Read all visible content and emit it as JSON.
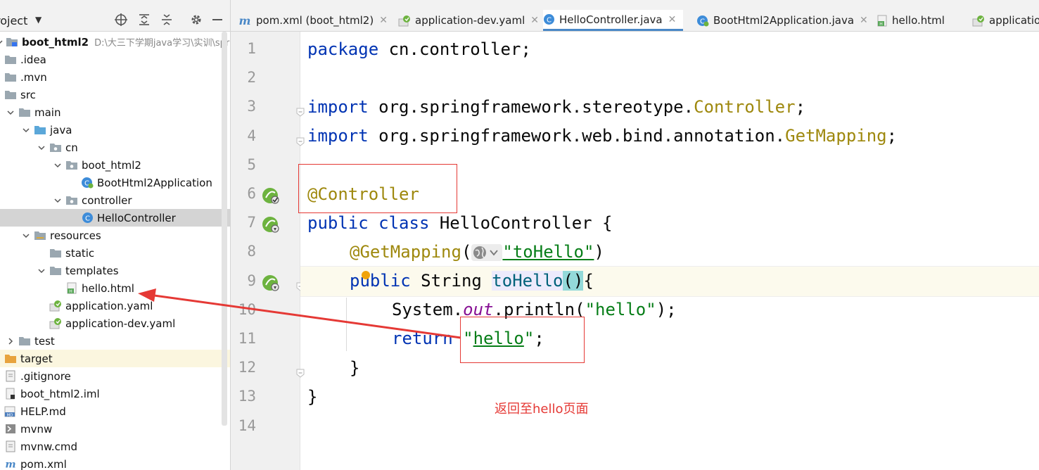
{
  "project": {
    "title": "roject",
    "tree": [
      {
        "label": "boot_html2",
        "extra": "D:\\大三下学期java学习\\实训\\spri",
        "type": "module",
        "indent": 0,
        "arrow": "down"
      },
      {
        "label": ".idea",
        "type": "folder",
        "indent": 0
      },
      {
        "label": ".mvn",
        "type": "folder",
        "indent": 0
      },
      {
        "label": "src",
        "type": "folder",
        "indent": 0
      },
      {
        "label": "main",
        "type": "folder",
        "indent": 1,
        "arrow": "down"
      },
      {
        "label": "java",
        "type": "folder-src",
        "indent": 2,
        "arrow": "down"
      },
      {
        "label": "cn",
        "type": "package",
        "indent": 3,
        "arrow": "down"
      },
      {
        "label": "boot_html2",
        "type": "package",
        "indent": 4,
        "arrow": "down"
      },
      {
        "label": "BootHtml2Application",
        "type": "spring-class",
        "indent": 5
      },
      {
        "label": "controller",
        "type": "package",
        "indent": 4,
        "arrow": "down"
      },
      {
        "label": "HelloController",
        "type": "class",
        "indent": 5,
        "selected": true
      },
      {
        "label": "resources",
        "type": "folder-res",
        "indent": 2,
        "arrow": "down"
      },
      {
        "label": "static",
        "type": "folder",
        "indent": 3
      },
      {
        "label": "templates",
        "type": "folder",
        "indent": 3,
        "arrow": "down"
      },
      {
        "label": "hello.html",
        "type": "html",
        "indent": 4
      },
      {
        "label": "application.yaml",
        "type": "yaml",
        "indent": 3
      },
      {
        "label": "application-dev.yaml",
        "type": "yaml",
        "indent": 3
      },
      {
        "label": "test",
        "type": "folder",
        "indent": 1,
        "arrow": "right"
      },
      {
        "label": "target",
        "type": "folder-excluded",
        "indent": 0,
        "excluded": true
      },
      {
        "label": ".gitignore",
        "type": "file",
        "indent": 0
      },
      {
        "label": "boot_html2.iml",
        "type": "iml",
        "indent": 0
      },
      {
        "label": "HELP.md",
        "type": "md",
        "indent": 0
      },
      {
        "label": "mvnw",
        "type": "shell",
        "indent": 0
      },
      {
        "label": "mvnw.cmd",
        "type": "file",
        "indent": 0
      },
      {
        "label": "pom.xml",
        "type": "maven",
        "indent": 0
      }
    ]
  },
  "tabs": [
    {
      "label": "pom.xml (boot_html2)",
      "icon": "maven",
      "closable": true
    },
    {
      "label": "application-dev.yaml",
      "icon": "yaml",
      "closable": true
    },
    {
      "label": "HelloController.java",
      "icon": "class",
      "closable": true,
      "active": true
    },
    {
      "label": "BootHtml2Application.java",
      "icon": "spring-class",
      "closable": true
    },
    {
      "label": "hello.html",
      "icon": "html",
      "closable": false
    },
    {
      "label": "applicatio",
      "icon": "yaml",
      "closable": false
    }
  ],
  "editor": {
    "line_numbers": [
      "1",
      "2",
      "3",
      "4",
      "5",
      "6",
      "7",
      "8",
      "9",
      "10",
      "11",
      "12",
      "13",
      "14"
    ],
    "code": {
      "l1_kw": "package",
      "l1_rest": " cn.controller;",
      "l3_kw": "import",
      "l3_rest": " org.springframework.stereotype.",
      "l3_cls": "Controller",
      "l3_end": ";",
      "l4_kw": "import",
      "l4_rest": " org.springframework.web.bind.annotation.",
      "l4_cls": "GetMapping",
      "l4_end": ";",
      "l6_ann": "@Controller",
      "l7_kw1": "public",
      "l7_kw2": "class",
      "l7_name": " HelloController {",
      "l8_ann": "@GetMapping",
      "l8_open": "(",
      "l8_str": "\"toHello\"",
      "l8_close": ")",
      "l9_kw": "public",
      "l9_type": " String ",
      "l9_method": "toHello",
      "l9_paren": "()",
      "l9_brace": "{",
      "l10_a": "System.",
      "l10_fld": "out",
      "l10_b": ".println(",
      "l10_str": "\"hello\"",
      "l10_c": ");",
      "l11_kw": "return",
      "l11_q1": "\"",
      "l11_str": "hello",
      "l11_q2": "\"",
      "l11_end": ";",
      "l12": "}",
      "l13": "}"
    }
  },
  "annotation": {
    "text": "返回至hello页面",
    "color": "#e53935"
  }
}
